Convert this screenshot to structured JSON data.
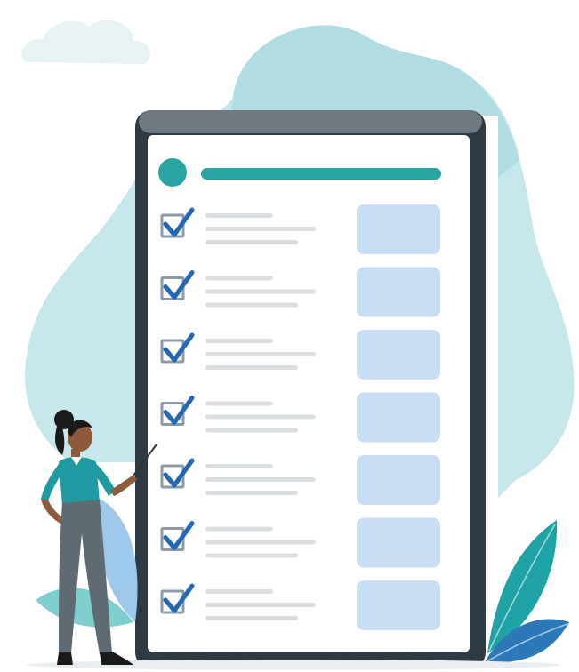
{
  "illustration": {
    "subject": "checklist-on-tablet-with-presenter",
    "colors": {
      "blob": "#bfe3e8",
      "blob_edge": "#7fc9d1",
      "cloud": "#e3f1f3",
      "device_frame": "#2f3b44",
      "device_frame_top": "#6e7981",
      "screen": "#ffffff",
      "accent_teal": "#2aa5a6",
      "checkbox_border": "#8a9aa8",
      "checkmark": "#2467b5",
      "text_line": "#dcdfe2",
      "card": "#c8def4",
      "skin": "#8d5a3b",
      "hair": "#1a1a1a",
      "shirt": "#1e9aa0",
      "pants": "#5f6b72",
      "leaf_teal": "#1fa3a4",
      "leaf_blue": "#2c78b8",
      "ground_shadow": "#e8eef0"
    },
    "checklist": {
      "items": [
        {
          "checked": true
        },
        {
          "checked": true
        },
        {
          "checked": true
        },
        {
          "checked": true
        },
        {
          "checked": true
        },
        {
          "checked": true
        },
        {
          "checked": true
        }
      ]
    }
  }
}
